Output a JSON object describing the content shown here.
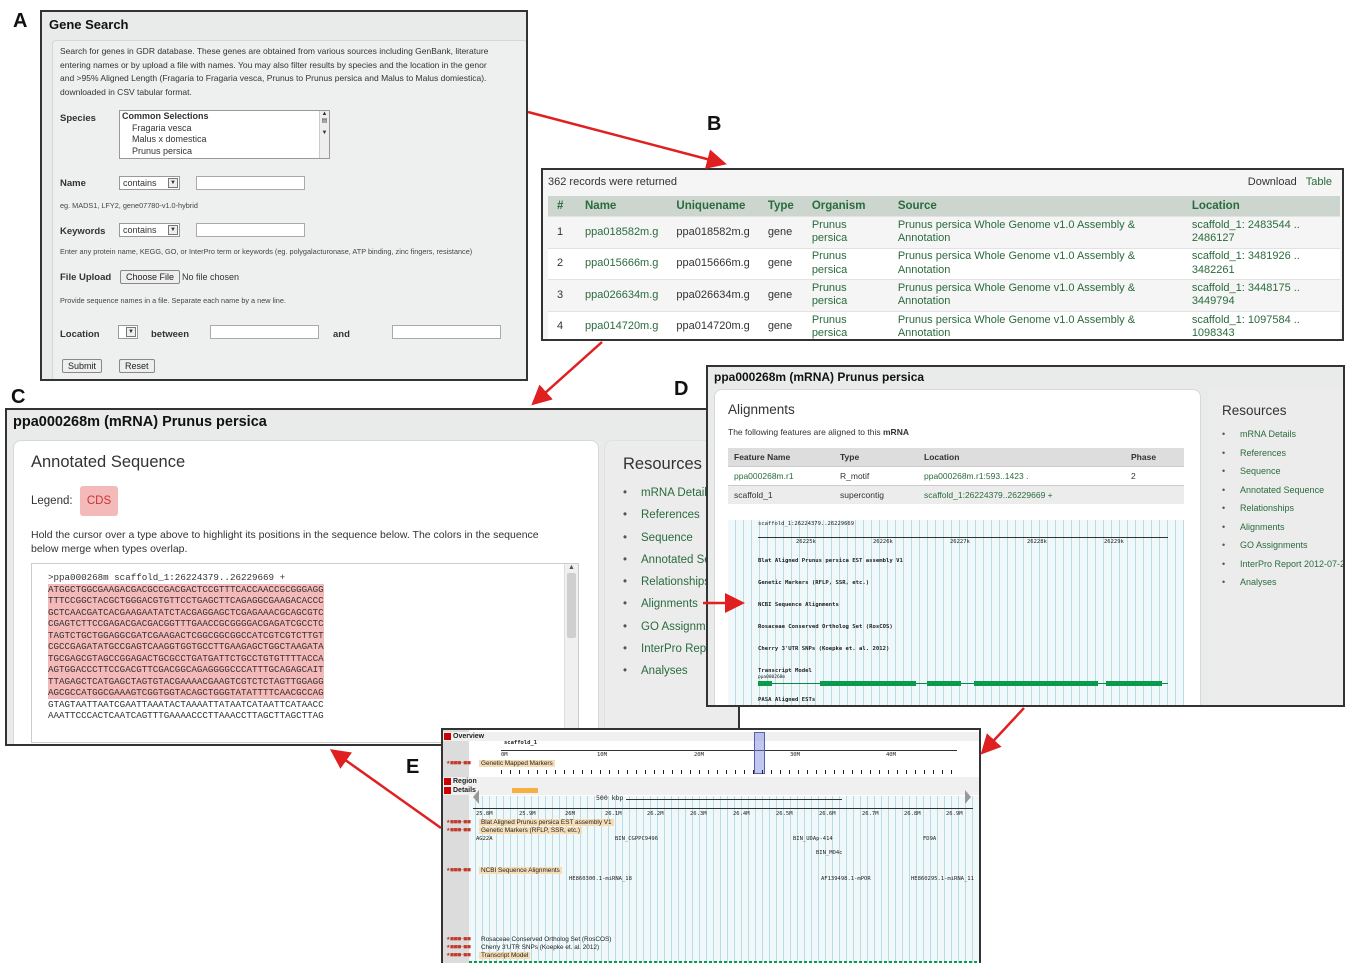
{
  "labels": {
    "a": "A",
    "b": "B",
    "c": "C",
    "d": "D",
    "e": "E"
  },
  "panelA": {
    "title": "Gene Search",
    "description": [
      "Search for genes in GDR database. These genes are obtained from various sources including GenBank, literature",
      "entering names or by upload a file with names. You may also filter results by species and the location in the genor",
      "and >95% Aligned Length (Fragaria to Fragaria vesca, Prunus to Prunus persica and Malus to Malus domiestica).",
      "downloaded in CSV tabular format."
    ],
    "species_label": "Species",
    "species_options": [
      "Common Selections",
      "Fragaria vesca",
      "Malus x domestica",
      "Prunus persica"
    ],
    "name_label": "Name",
    "name_op": "contains",
    "name_hint": "eg. MADS1, LFY2, gene07780-v1.0-hybrid",
    "keywords_label": "Keywords",
    "keywords_op": "contains",
    "keywords_hint": "Enter any protein name, KEGG, GO, or InterPro term or keywords (eg. polygalacturonase, ATP binding, zinc fingers, resistance)",
    "upload_label": "File Upload",
    "choose_file": "Choose File",
    "no_file": "No file chosen",
    "upload_hint": "Provide sequence names in a file. Separate each name by a new line.",
    "location_label": "Location",
    "between": "between",
    "and": "and",
    "submit": "Submit",
    "reset": "Reset"
  },
  "panelB": {
    "records_count": "362",
    "records_text": "records were returned",
    "download": "Download",
    "table_link": "Table",
    "columns": [
      "#",
      "Name",
      "Uniquename",
      "Type",
      "Organism",
      "Source",
      "Location"
    ],
    "rows": [
      {
        "n": "1",
        "name": "ppa018582m.g",
        "uniq": "ppa018582m.g",
        "type": "gene",
        "org1": "Prunus",
        "org2": "persica",
        "src1": "Prunus persica Whole Genome v1.0 Assembly &",
        "src2": "Annotation",
        "loc1": "scaffold_1: 2483544 ..",
        "loc2": "2486127"
      },
      {
        "n": "2",
        "name": "ppa015666m.g",
        "uniq": "ppa015666m.g",
        "type": "gene",
        "org1": "Prunus",
        "org2": "persica",
        "src1": "Prunus persica Whole Genome v1.0 Assembly &",
        "src2": "Annotation",
        "loc1": "scaffold_1: 3481926 ..",
        "loc2": "3482261"
      },
      {
        "n": "3",
        "name": "ppa026634m.g",
        "uniq": "ppa026634m.g",
        "type": "gene",
        "org1": "Prunus",
        "org2": "persica",
        "src1": "Prunus persica Whole Genome v1.0 Assembly &",
        "src2": "Annotation",
        "loc1": "scaffold_1: 3448175 ..",
        "loc2": "3449794"
      },
      {
        "n": "4",
        "name": "ppa014720m.g",
        "uniq": "ppa014720m.g",
        "type": "gene",
        "org1": "Prunus",
        "org2": "persica",
        "src1": "Prunus persica Whole Genome v1.0 Assembly &",
        "src2": "Annotation",
        "loc1": "scaffold_1: 1097584 ..",
        "loc2": "1098343"
      }
    ]
  },
  "panelC": {
    "title": "ppa000268m (mRNA) Prunus persica",
    "heading": "Annotated Sequence",
    "legend_label": "Legend:",
    "legend_item": "CDS",
    "instruction1": "Hold the cursor over a type above to highlight its positions in the sequence below. The colors in the sequence",
    "instruction2": "below merge when types overlap.",
    "fasta_header": ">ppa000268m scaffold_1:26224379..26229669 +",
    "seq_lines": [
      "ATGGCTGGCGAAGACGACGCCGACGACTCCGTTTCACCAACCGCGGGAGG",
      "TTTCCGGCTACGCTGGGACGTGTTCCTGAGCTTCAGAGGCGAAGACACCC",
      "GCTCAACGATCACGAAGAATATCTACGAGGAGCTCGAGAAACGCAGCGTC",
      "CGAGTCTTCCGAGACGACGACGGTTTGAACCGCGGGGACGAGATCGCCTC",
      "TAGTCTGCTGGAGGCGATCGAAGACTCGGCGGCGGCCATCGTCGTCTTGT",
      "CGCCGAGATATGCCGAGTCAAGGTGGTGCCTTGAAGAGCTGGCTAAGATA",
      "TGCGAGCGTAGCCGGAGACTGCGCCTGATGATTCTGCCTGTGTTTTACCA",
      "AGTGGACCCTTCCGACGTTCGACGGCAGAGGGGCCCATTTGCAGAGCAIT",
      "TTAGAGCTCATGAGCTAGTGTACGAAAACGAAGTCGTCTCTAGTTGGAGG",
      "AGCGCCATGGCGAAAGTCGGTGGTACAGCTGGGTATATTTTCAACGCCAG",
      "GTAGTAATTAATCGAATTAAATACTAAAATTATAATCATAATTCATAACC",
      "AAATTCCCACTCAATCAGTTTGAAAACCCTTAAACCTTAGCTTAGCTTAG"
    ],
    "resources_title": "Resources",
    "resources": [
      "mRNA Details",
      "References",
      "Sequence",
      "Annotated Se",
      "Relationships",
      "Alignments",
      "GO Assignm",
      "InterPro Repo",
      "Analyses"
    ]
  },
  "panelD": {
    "title": "ppa000268m (mRNA) Prunus persica",
    "heading": "Alignments",
    "subtext_pre": "The following features are aligned to this",
    "subtext_bold": "mRNA",
    "columns": [
      "Feature Name",
      "Type",
      "Location",
      "Phase"
    ],
    "rows": [
      {
        "name": "ppa000268m.r1",
        "type": "R_motif",
        "loc": "ppa000268m.r1:593..1423 .",
        "phase": "2"
      },
      {
        "name": "scaffold_1",
        "type": "supercontig",
        "loc": "scaffold_1:26224379..26229669 +",
        "phase": ""
      }
    ],
    "gb_title": "scaffold_1:26224379..26229669",
    "gb_ticks": [
      "26225k",
      "26226k",
      "26227k",
      "26228k",
      "26229k"
    ],
    "tracks": [
      "Blat Aligned Prunus persica EST assembly V1",
      "Genetic Markers (RFLP, SSR, etc.)",
      "NCBI Sequence Alignments",
      "Rosaceae Conserved Ortholog Set (RosCOS)",
      "Cherry 3'UTR SNPs (Koepke et. al. 2012)",
      "Transcript Model",
      "PASA Aligned ESTs"
    ],
    "transcript_label": "ppa000268m",
    "resources_title": "Resources",
    "resources": [
      "mRNA Details",
      "References",
      "Sequence",
      "Annotated Sequence",
      "Relationships",
      "Alignments",
      "GO Assignments",
      "InterPro Report 2012-07-2",
      "Analyses"
    ]
  },
  "panelE": {
    "overview": "Overview",
    "scaffold": "scaffold_1",
    "overview_ticks": [
      "0M",
      "10M",
      "20M",
      "30M",
      "40M"
    ],
    "track_markers": "Genetic Mapped Markers",
    "region": "Region",
    "details": "Details",
    "scale": "500 kbp",
    "detail_ticks": [
      "25.8M",
      "25.9M",
      "26M",
      "26.1M",
      "26.2M",
      "26.3M",
      "26.4M",
      "26.5M",
      "26.6M",
      "26.7M",
      "26.8M",
      "26.9M"
    ],
    "tracks": {
      "blat": "Blat Aligned Prunus persica EST assembly V1",
      "markers": "Genetic Markers (RFLP, SSR, etc.)",
      "ncbi": "NCBI Sequence Alignments",
      "roscos": "Rosaceae Conserved Ortholog Set (RosCOS)",
      "cherry": "Cherry 3'UTR SNPs (Koepke et. al. 2012)",
      "transcript": "Transcript Model"
    },
    "feature_labels": {
      "ag22": "AG22A",
      "bin1": "BIN_CGPPC9496",
      "bin2": "BIN_UDAp-414",
      "bin3": "BIN_MO4c",
      "fd": "FD9A",
      "he1": "HE860300.1-miRNA_18",
      "af": "AF139498.1-mPOR",
      "he2": "HE860295.1-miRNA_11"
    }
  }
}
